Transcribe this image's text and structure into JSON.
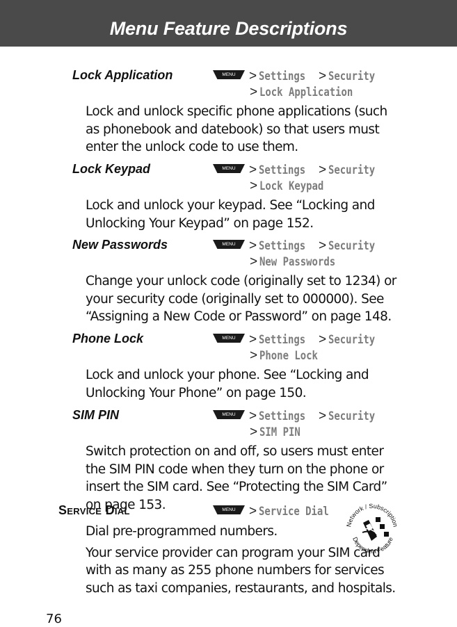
{
  "header": {
    "title": "Menu Feature Descriptions"
  },
  "menu_key_label": "MENU",
  "separator": ">",
  "entries": [
    {
      "name": "Lock Application",
      "path_line1": [
        "Settings",
        "Security"
      ],
      "path_line2": "Lock Application",
      "description": [
        "Lock and unlock specific phone applications (such as phonebook and datebook) so that users must enter the unlock code to use them."
      ]
    },
    {
      "name": "Lock Keypad",
      "path_line1": [
        "Settings",
        "Security"
      ],
      "path_line2": "Lock Keypad",
      "description": [
        "Lock and unlock your keypad. See “Locking and Unlocking Your Keypad” on page 152."
      ]
    },
    {
      "name": "New Passwords",
      "path_line1": [
        "Settings",
        "Security"
      ],
      "path_line2": "New Passwords",
      "description": [
        "Change your unlock code (originally set to 1234) or your security code (originally set to 000000). See “Assigning a New Code or Password” on page 148."
      ]
    },
    {
      "name": "Phone Lock",
      "path_line1": [
        "Settings",
        "Security"
      ],
      "path_line2": "Phone Lock",
      "description": [
        "Lock and unlock your phone. See “Locking and Unlocking Your Phone” on page 150."
      ]
    },
    {
      "name": "SIM PIN",
      "path_line1": [
        "Settings",
        "Security"
      ],
      "path_line2": "SIM PIN",
      "description": [
        "Switch protection on and off, so users must enter the SIM PIN code when they turn on the phone or insert the SIM card. See “Protecting the SIM Card” on page 153."
      ]
    }
  ],
  "service_dial": {
    "name": "Service Dial",
    "path": "Service Dial",
    "description": [
      "Dial pre-programmed numbers.",
      "Your service provider can program your SIM card with as many as 255 phone numbers for services such as taxi companies, restaurants, and hospitals."
    ],
    "badge": {
      "top_text": "Network / Subscription",
      "bottom_text": "Dependent Feature",
      "icon": "network-phone-icon"
    }
  },
  "page_number": "76"
}
